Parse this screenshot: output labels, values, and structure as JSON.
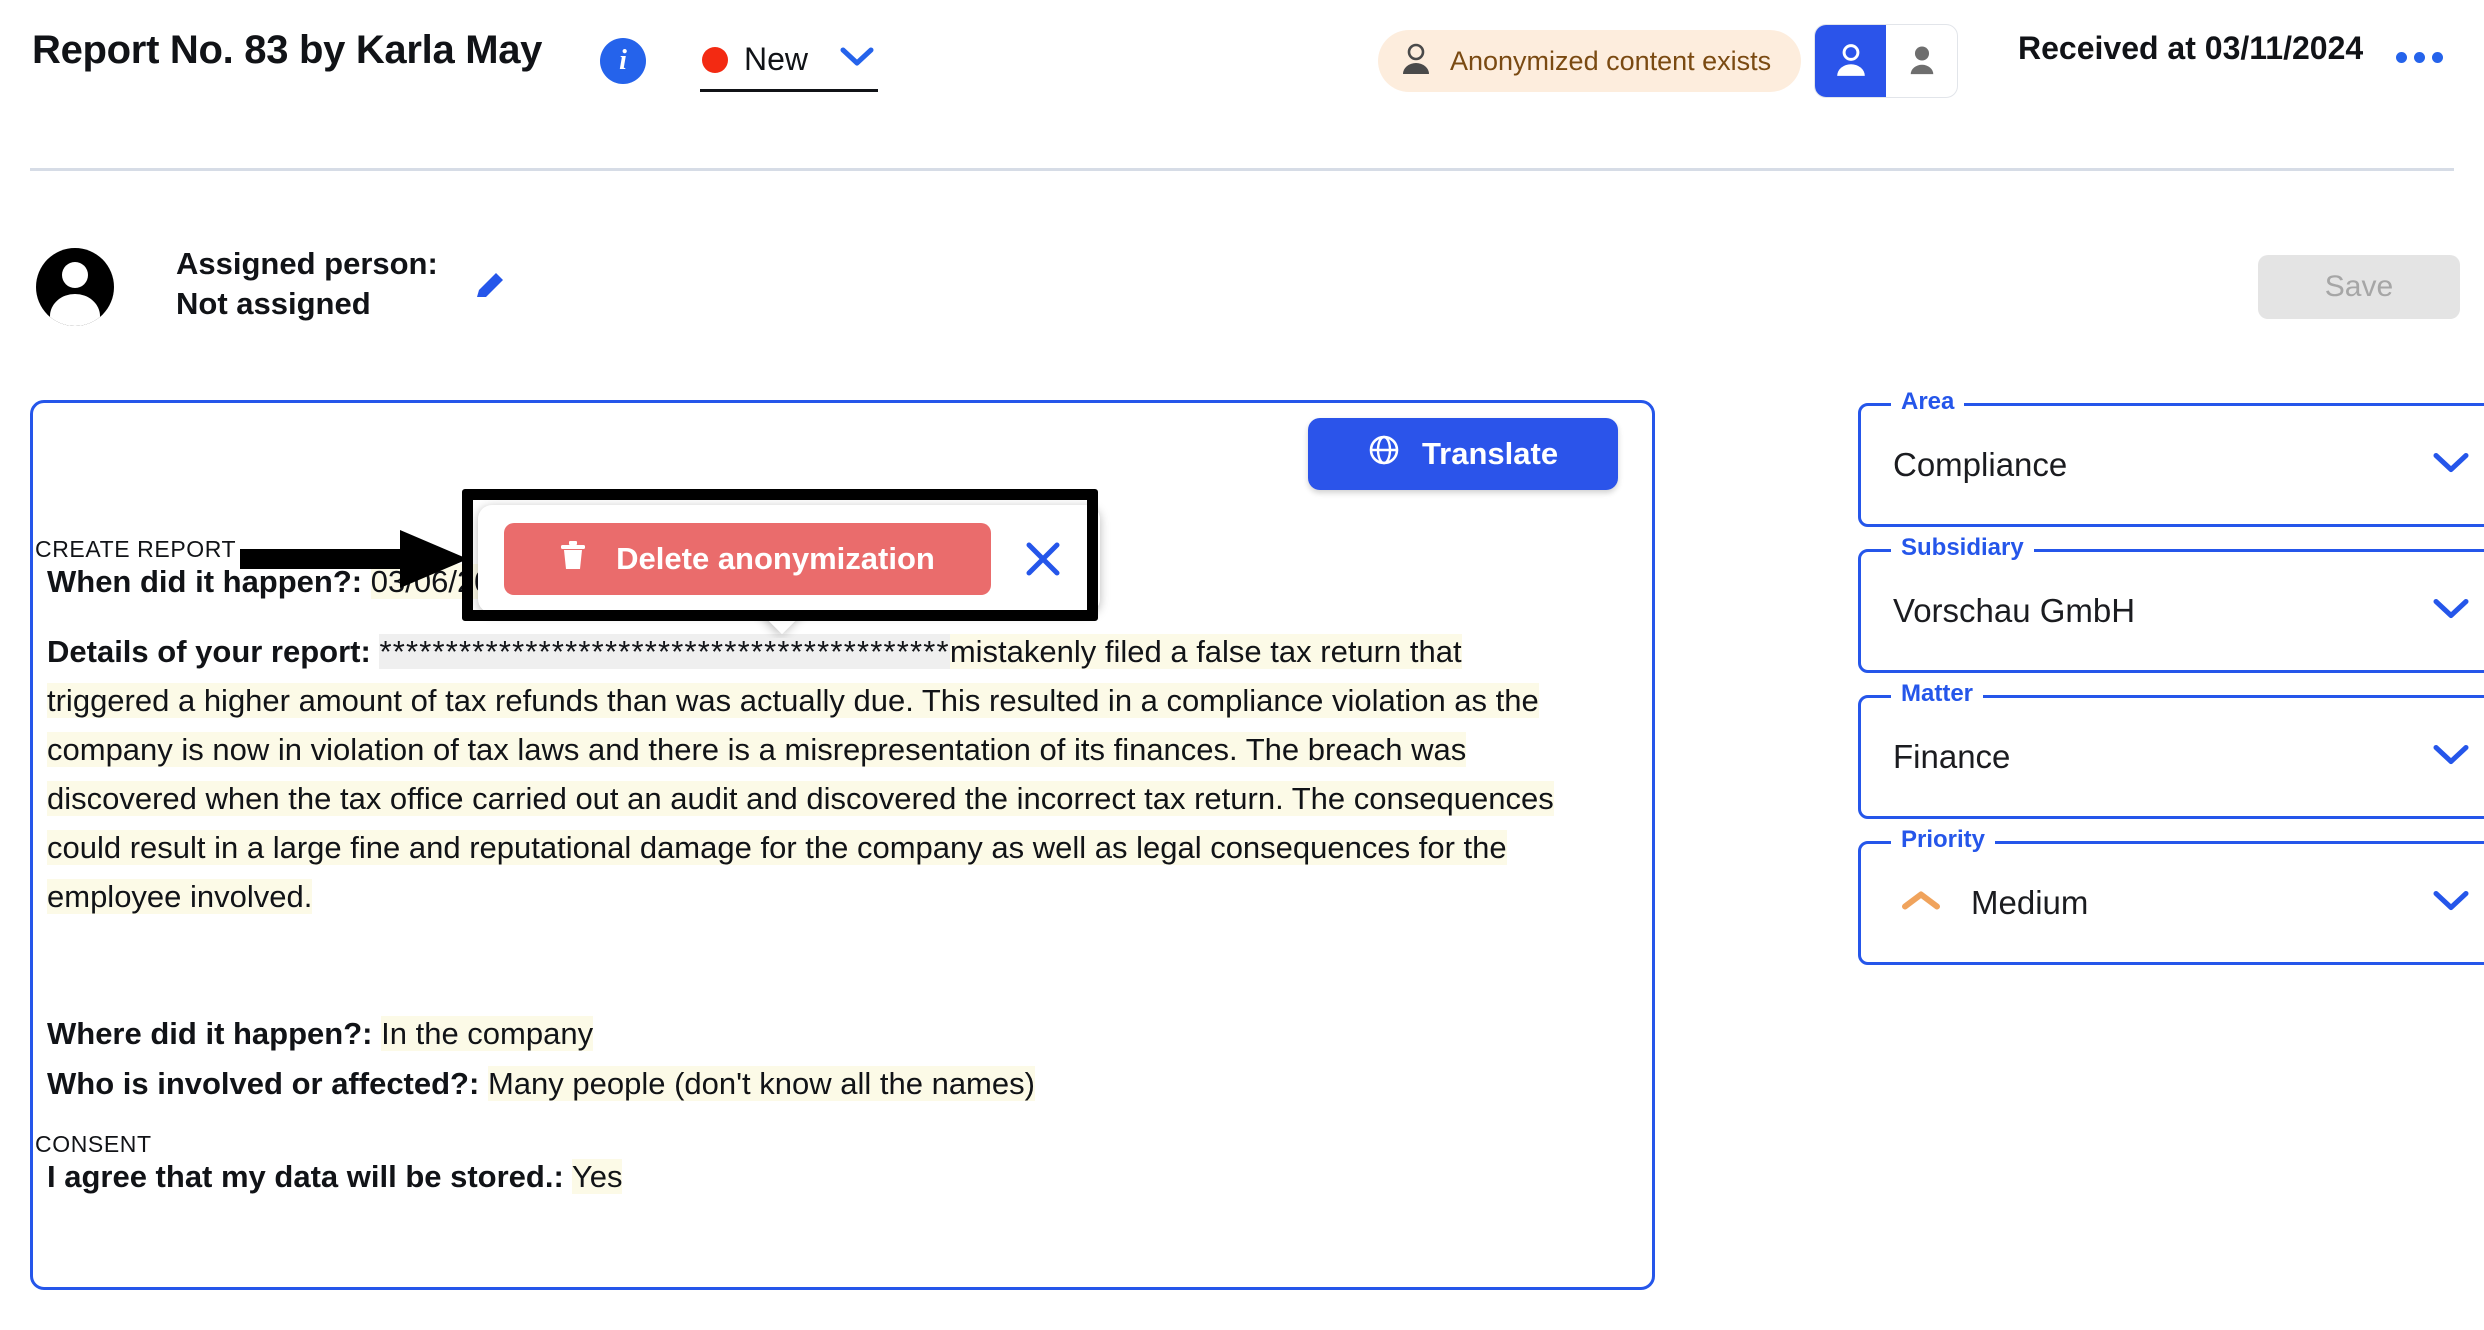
{
  "header": {
    "title": "Report No. 83 by Karla May",
    "info_icon": "info-icon",
    "status": {
      "label": "New",
      "dot_color": "#F32A12",
      "caret_icon": "chevron-down-icon"
    },
    "anonymized_pill": {
      "label": "Anonymized content exists",
      "icon": "person-outline-icon",
      "bg": "#FDEDDD",
      "fg": "#7A4A12"
    },
    "view_toggle": {
      "left_icon": "person-outline-icon",
      "right_icon": "person-filled-icon",
      "active": "left",
      "active_color": "#2B54EA"
    },
    "received": "Received at 03/11/2024",
    "more_icon": "more-horizontal-icon"
  },
  "assignee": {
    "avatar_icon": "user-avatar-icon",
    "label": "Assigned person:",
    "value": "Not assigned",
    "edit_icon": "pencil-icon"
  },
  "save_button": {
    "label": "Save",
    "enabled": false
  },
  "report": {
    "translate_button": {
      "label": "Translate",
      "icon": "globe-icon",
      "color": "#2B54EA"
    },
    "section_create": "CREATE REPORT",
    "section_consent": "CONSENT",
    "when": {
      "question": "When did it happen?:",
      "answer": "03/06/2024"
    },
    "details": {
      "question": "Details of your report:",
      "redacted": "*******************************************",
      "answer": "mistakenly filed a false tax return that triggered a higher amount of tax refunds than was actually due. This resulted in a compliance violation as the company is now in violation of tax laws and there is a misrepresentation of its finances. The breach was discovered when the tax office carried out an audit and discovered the incorrect tax return. The consequences could result in a large fine and reputational damage for the company as well as legal consequences for the employee involved."
    },
    "where": {
      "question": "Where did it happen?:",
      "answer": "In the company"
    },
    "who": {
      "question": "Who is involved or affected?:",
      "answer": "Many people (don't know all the names)"
    },
    "consent": {
      "question": "I agree that my data will be stored.:",
      "answer": "Yes"
    }
  },
  "popover": {
    "delete_button": {
      "label": "Delete anonymization",
      "icon": "trash-icon",
      "color": "#EA6C6C"
    },
    "close_icon": "close-x-icon"
  },
  "sidebar_fields": [
    {
      "legend": "Area",
      "value": "Compliance",
      "caret_icon": "chevron-down-icon"
    },
    {
      "legend": "Subsidiary",
      "value": "Vorschau GmbH",
      "caret_icon": "chevron-down-icon"
    },
    {
      "legend": "Matter",
      "value": "Finance",
      "caret_icon": "chevron-down-icon"
    },
    {
      "legend": "Priority",
      "value": "Medium",
      "caret_icon": "chevron-down-icon",
      "prio_icon": "chevron-up-orange-icon"
    }
  ],
  "colors": {
    "accent_blue": "#2556EA",
    "button_blue": "#2B54EA",
    "danger_red": "#EA6C6C",
    "status_red": "#F32A12",
    "highlight_yellow": "#FCFAE7",
    "redaction_gray": "#EFEFEF",
    "priority_orange": "#F0A35C"
  }
}
